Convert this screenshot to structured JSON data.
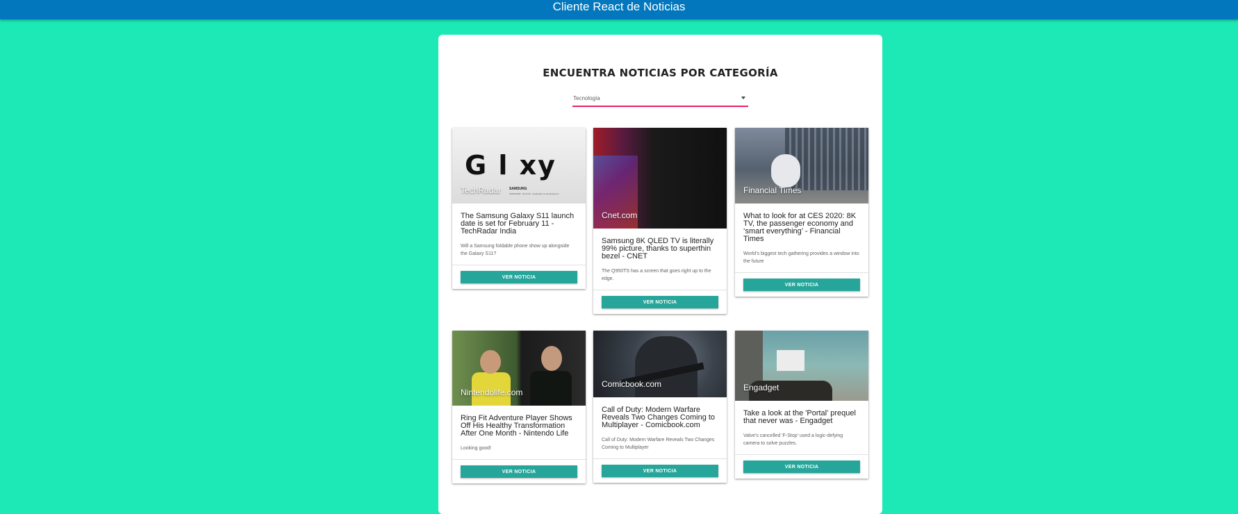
{
  "app": {
    "title": "Cliente React de Noticias"
  },
  "main": {
    "heading": "ENCUENTRA NOTICIAS POR CATEGORÍA",
    "category_select": {
      "value": "Tecnología"
    }
  },
  "colors": {
    "background": "#1de9b6",
    "topbar": "#0277bd",
    "button": "#26a69a",
    "select_underline": "#e91e63"
  },
  "news": [
    {
      "source": "TechRadar",
      "title": "The Samsung Galaxy S11 launch date is set for February 11 - TechRadar India",
      "description": "Will a Samsung foldable phone show up alongside the Galaxy S11?",
      "button": "VER NOTICIA",
      "image_text": {
        "word": "G  l  xy",
        "brand": "SAMSUNG",
        "fine": "UNPACKED · 02.11.20 · Livestream on samsung.com"
      }
    },
    {
      "source": "Cnet.com",
      "title": "Samsung 8K QLED TV is literally 99% picture, thanks to superthin bezel - CNET",
      "description": "The Q950TS has a screen that goes right up to the edge.",
      "button": "VER NOTICIA"
    },
    {
      "source": "Financial Times",
      "title": "What to look for at CES 2020: 8K TV, the passenger economy and ‘smart everything’ - Financial Times",
      "description": "World’s biggest tech gathering provides a window into the future",
      "button": "VER NOTICIA"
    },
    {
      "source": "Nintendolife.com",
      "title": "Ring Fit Adventure Player Shows Off His Healthy Transformation After One Month - Nintendo Life",
      "description": "Looking good!",
      "button": "VER NOTICIA"
    },
    {
      "source": "Comicbook.com",
      "title": "Call of Duty: Modern Warfare Reveals Two Changes Coming to Multiplayer - Comicbook.com",
      "description": "Call of Duty: Modern Warfare Reveals Two Changes Coming to Multiplayer",
      "button": "VER NOTICIA"
    },
    {
      "source": "Engadget",
      "title": "Take a look at the 'Portal' prequel that never was - Engadget",
      "description": "Valve's cancelled 'F-Stop' used a logic-defying camera to solve puzzles.",
      "button": "VER NOTICIA"
    }
  ]
}
